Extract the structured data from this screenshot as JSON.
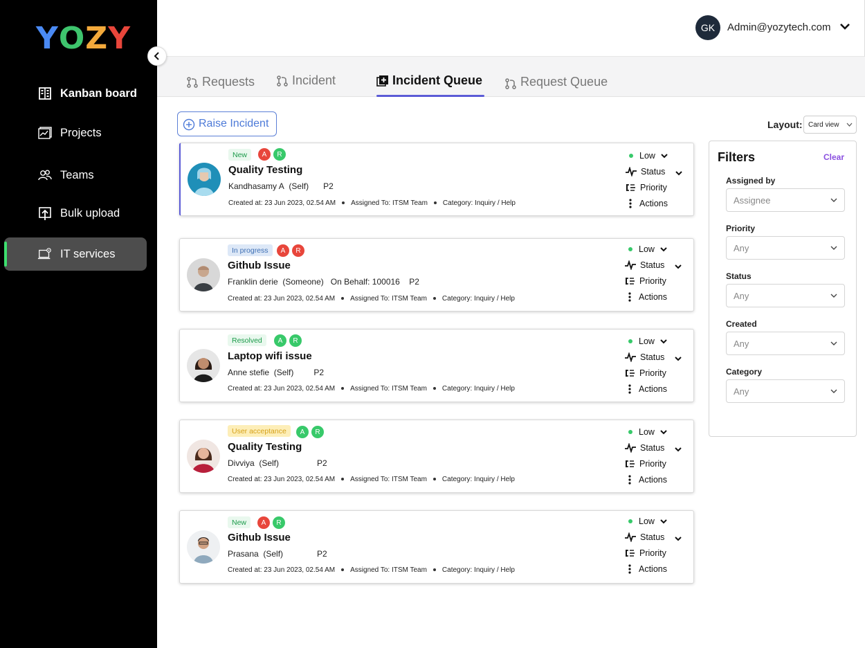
{
  "logo": {
    "letters": [
      "Y",
      "O",
      "Z",
      "Y"
    ],
    "colors": [
      "#4a8af4",
      "#3ec46d",
      "#f3a93b",
      "#e8463b"
    ]
  },
  "sidebar": {
    "items": [
      {
        "label": "Kanban board",
        "icon": "kanban-icon"
      },
      {
        "label": "Projects",
        "icon": "projects-icon"
      },
      {
        "label": "Teams",
        "icon": "teams-icon"
      },
      {
        "label": "Bulk upload",
        "icon": "upload-icon"
      },
      {
        "label": "IT services",
        "icon": "it-services-icon",
        "active": true
      }
    ]
  },
  "header": {
    "avatar_initials": "GK",
    "email": "Admin@yozytech.com"
  },
  "tabs": [
    {
      "label": "Requests"
    },
    {
      "label": "Incident"
    },
    {
      "label": "Incident Queue",
      "active": true
    },
    {
      "label": "Request Queue"
    }
  ],
  "toolbar": {
    "raise_label": "Raise Incident",
    "layout_label": "Layout:",
    "layout_value": "Card view"
  },
  "cards": [
    {
      "status": "New",
      "chips": [
        "A",
        "R"
      ],
      "title": "Quality Testing",
      "requester": "Kandhasamy A",
      "relation": "(Self)",
      "on_behalf": "",
      "priority_code": "P2",
      "created": "Created at: 23 Jun 2023, 02.54 AM",
      "assigned": "Assigned To: ITSM Team",
      "category": "Category: Inquiry / Help",
      "level": "Low",
      "status_label": "Status",
      "priority_label": "Priority",
      "actions_label": "Actions"
    },
    {
      "status": "In progress",
      "chips": [
        "A",
        "R"
      ],
      "title": "Github Issue",
      "requester": "Franklin derie",
      "relation": "(Someone)",
      "on_behalf": "On Behalf:  100016",
      "priority_code": "P2",
      "created": "Created at: 23 Jun 2023, 02.54 AM",
      "assigned": "Assigned To: ITSM Team",
      "category": "Category: Inquiry / Help",
      "level": "Low",
      "status_label": "Status",
      "priority_label": "Priority",
      "actions_label": "Actions"
    },
    {
      "status": "Resolved",
      "chips": [
        "A",
        "R"
      ],
      "title": "Laptop wifi issue",
      "requester": "Anne stefie",
      "relation": "(Self)",
      "on_behalf": "",
      "priority_code": "P2",
      "created": "Created at: 23 Jun 2023, 02.54 AM",
      "assigned": "Assigned To: ITSM Team",
      "category": "Category: Inquiry / Help",
      "level": "Low",
      "status_label": "Status",
      "priority_label": "Priority",
      "actions_label": "Actions"
    },
    {
      "status": "User acceptance",
      "chips": [
        "A",
        "R"
      ],
      "title": "Quality Testing",
      "requester": "Divviya",
      "relation": "(Self)",
      "on_behalf": "",
      "priority_code": "P2",
      "created": "Created at: 23 Jun 2023, 02.54 AM",
      "assigned": "Assigned To: ITSM Team",
      "category": "Category: Inquiry / Help",
      "level": "Low",
      "status_label": "Status",
      "priority_label": "Priority",
      "actions_label": "Actions"
    },
    {
      "status": "New",
      "chips": [
        "A",
        "R"
      ],
      "title": "Github Issue",
      "requester": "Prasana",
      "relation": "(Self)",
      "on_behalf": "",
      "priority_code": "P2",
      "created": "Created at: 23 Jun 2023, 02.54 AM",
      "assigned": "Assigned To: ITSM Team",
      "category": "Category: Inquiry / Help",
      "level": "Low",
      "status_label": "Status",
      "priority_label": "Priority",
      "actions_label": "Actions"
    }
  ],
  "filters": {
    "title": "Filters",
    "clear_label": "Clear",
    "fields": [
      {
        "label": "Assigned by",
        "value": "Assignee"
      },
      {
        "label": "Priority",
        "value": "Any"
      },
      {
        "label": "Status",
        "value": "Any"
      },
      {
        "label": "Created",
        "value": "Any"
      },
      {
        "label": "Category",
        "value": "Any"
      }
    ]
  }
}
